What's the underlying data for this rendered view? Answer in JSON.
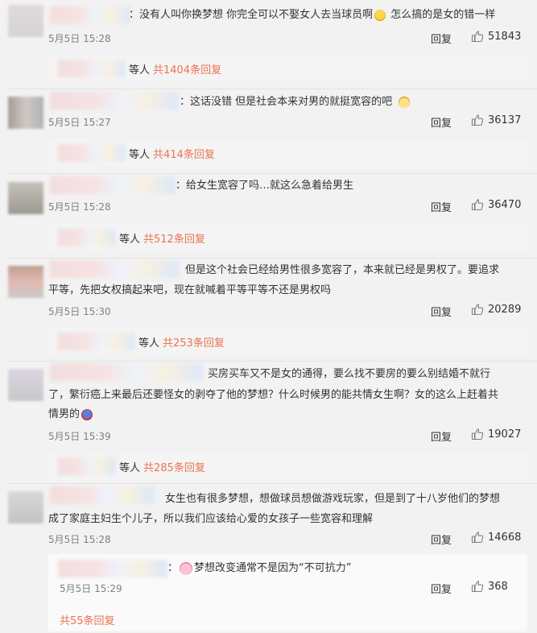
{
  "comments": [
    {
      "text": "：没有人叫你换梦想 你完全可以不娶女人去当球员啊",
      "text_tail": " 怎么搞的是女的错一样",
      "time": "5月5日 15:28",
      "reply": "回复",
      "likes": "51843",
      "sub_prefix": "等人",
      "sub_link": "共1404条回复"
    },
    {
      "text": "：这话没错 但是社会本来对男的就挺宽容的吧",
      "text_tail": "",
      "time": "5月5日 15:27",
      "reply": "回复",
      "likes": "36137",
      "sub_prefix": "等人",
      "sub_link": "共414条回复"
    },
    {
      "text": "：给女生宽容了吗…就这么急着给男生",
      "text_tail": "",
      "time": "5月5日 15:28",
      "reply": "回复",
      "likes": "36470",
      "sub_prefix": "等人",
      "sub_link": "共512条回复"
    },
    {
      "text_l1": "但是这个社会已经给男性很多宽容了，本来就已经是男权了。要追求",
      "text_l2": "平等，先把女权搞起来吧，现在就喊着平等平等不还是男权吗",
      "time": "5月5日 15:30",
      "reply": "回复",
      "likes": "20289",
      "sub_prefix": "等人",
      "sub_link": "共253条回复"
    },
    {
      "text_l1": "买房买车又不是女的通得，要么找不要房的要么别结婚不就行",
      "text_l2": "了，繁衍癌上来最后还要怪女的剥夺了他的梦想？什么时候男的能共情女生啊？女的这么上赶着共",
      "text_l3": "情男的",
      "time": "5月5日 15:39",
      "reply": "回复",
      "likes": "19027",
      "sub_prefix": "等人",
      "sub_link": "共285条回复"
    },
    {
      "text_l1": "女生也有很多梦想，想做球员想做游戏玩家，但是到了十八岁他们的梦想",
      "text_l2": "成了家庭主妇生个儿子，所以我们应该给心爱的女孩子一些宽容和理解",
      "time": "5月5日 15:28",
      "reply": "回复",
      "likes": "14668",
      "nested": {
        "text": "：",
        "text_tail": "梦想改变通常不是因为“不可抗力”",
        "time": "5月5日 15:29",
        "reply": "回复",
        "likes": "368"
      },
      "more_link": "共55条回复"
    }
  ],
  "icons": {
    "like": "thumbs-up-icon"
  },
  "colors": {
    "accent": "#eb7350",
    "meta": "#808080",
    "background": "#f2f2f2"
  }
}
